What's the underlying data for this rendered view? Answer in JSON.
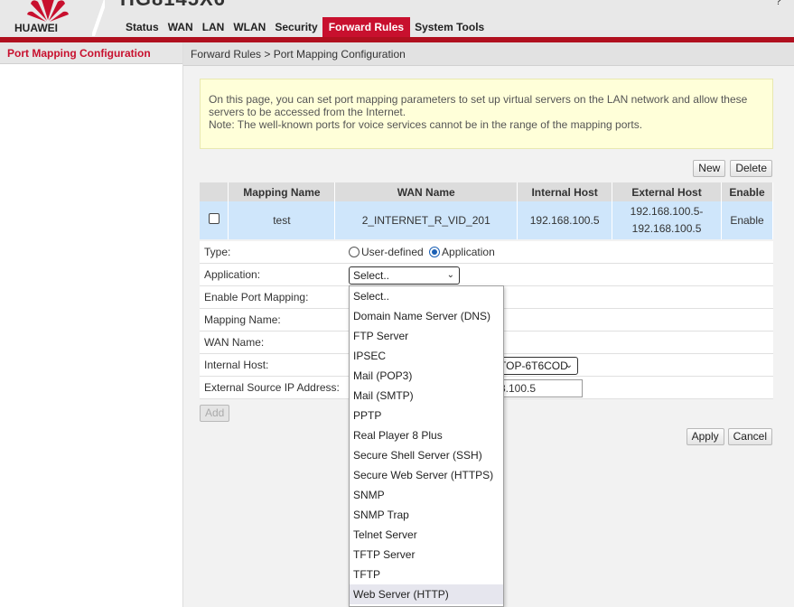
{
  "header": {
    "brand": "HUAWEI",
    "product": "HG8145X6",
    "user_corner": "?",
    "nav": [
      "Status",
      "WAN",
      "LAN",
      "WLAN",
      "Security",
      "Forward Rules",
      "System Tools"
    ],
    "active_nav": "Forward Rules",
    "accent_color": "#c8102e"
  },
  "sidebar": {
    "items": [
      {
        "label": "Port Mapping Configuration"
      }
    ]
  },
  "breadcrumb": "Forward Rules > Port Mapping Configuration",
  "note": {
    "line1": "On this page, you can set port mapping parameters to set up virtual servers on the LAN network and allow these servers to be accessed from the Internet.",
    "line2": "Note: The well-known ports for voice services cannot be in the range of the mapping ports."
  },
  "buttons": {
    "new": "New",
    "delete": "Delete",
    "add": "Add",
    "apply": "Apply",
    "cancel": "Cancel"
  },
  "table": {
    "headers": [
      "",
      "Mapping Name",
      "WAN Name",
      "Internal Host",
      "External Host",
      "Enable"
    ],
    "rows": [
      {
        "name": "test",
        "wan": "2_INTERNET_R_VID_201",
        "internal": "192.168.100.5",
        "external1": "192.168.100.5-",
        "external2": "192.168.100.5",
        "enable": "Enable"
      }
    ]
  },
  "form": {
    "type_label": "Type:",
    "type_options": [
      "User-defined",
      "Application"
    ],
    "type_selected": "Application",
    "application_label": "Application:",
    "application_value": "Select..",
    "enable_label": "Enable Port Mapping:",
    "mapping_name_label": "Mapping Name:",
    "wan_name_label": "WAN Name:",
    "internal_host_label": "Internal Host:",
    "internal_host_value": "TOP-6T6COD",
    "external_ip_label": "External Source IP Address:",
    "external_ip_value": "8.100.5"
  },
  "dropdown": {
    "options": [
      "Select..",
      "Domain Name Server (DNS)",
      "FTP Server",
      "IPSEC",
      "Mail (POP3)",
      "Mail (SMTP)",
      "PPTP",
      "Real Player 8 Plus",
      "Secure Shell Server (SSH)",
      "Secure Web Server (HTTPS)",
      "SNMP",
      "SNMP Trap",
      "Telnet Server",
      "TFTP Server",
      "TFTP",
      "Web Server (HTTP)"
    ],
    "highlighted": "Web Server (HTTP)"
  }
}
